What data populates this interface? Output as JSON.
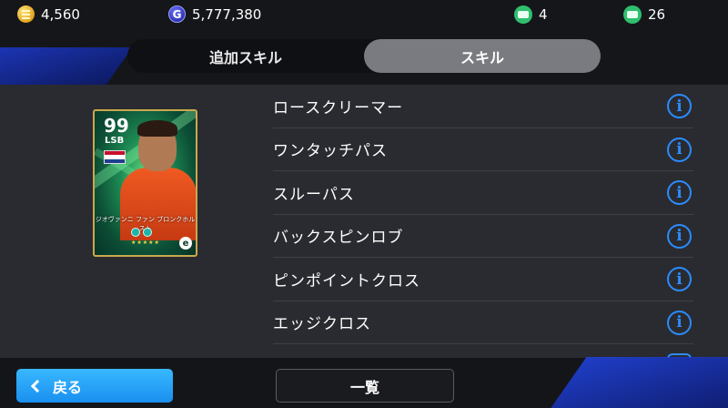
{
  "currencies": {
    "coins": "4,560",
    "gp": "5,777,380",
    "gp_symbol": "G",
    "ticket_a": "4",
    "ticket_b": "26"
  },
  "tabs": [
    {
      "label": "追加スキル",
      "active": false
    },
    {
      "label": "スキル",
      "active": true
    }
  ],
  "card": {
    "rating": "99",
    "position": "LSB",
    "name": "ジオヴァンニ ファン ブロンクホルスト",
    "stars": "★★★★★",
    "emblem": "e"
  },
  "skills": [
    {
      "label": "ロースクリーマー"
    },
    {
      "label": "ワンタッチパス"
    },
    {
      "label": "スルーパス"
    },
    {
      "label": "バックスピンロブ"
    },
    {
      "label": "ピンポイントクロス"
    },
    {
      "label": "エッジクロス"
    }
  ],
  "info_symbol": "i",
  "buttons": {
    "back": "戻る",
    "list": "一覧"
  },
  "colors": {
    "accent_blue": "#2b8cff",
    "back_button": "#1a8fef",
    "tab_active": "#7a7b80",
    "panel": "#2a2b30"
  }
}
